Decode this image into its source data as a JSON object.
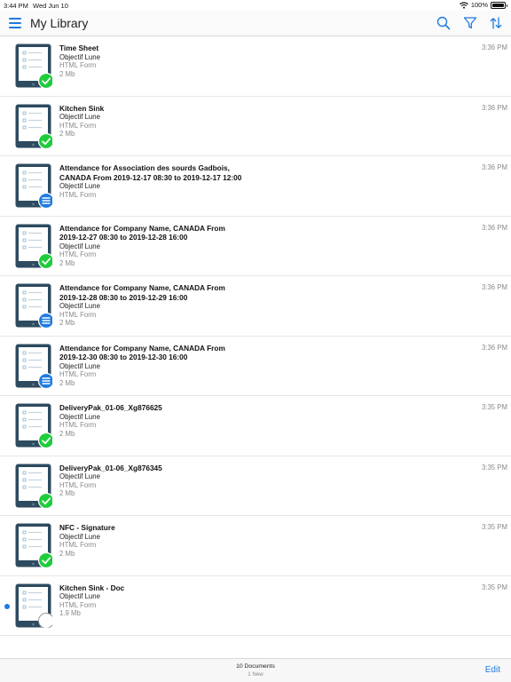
{
  "status_bar": {
    "time": "3:44 PM",
    "date": "Wed Jun 10",
    "battery": "100%",
    "battery_level": 1.0
  },
  "nav": {
    "title": "My Library",
    "menu_icon": "hamburger-menu-icon",
    "search_icon": "search-icon",
    "filter_icon": "filter-icon",
    "sort_icon": "sort-icon"
  },
  "colors": {
    "accent": "#1e7be0",
    "check_badge": "#1fcc3c",
    "form_badge": "#1e7be0",
    "device_frame": "#2d4a5f"
  },
  "documents": [
    {
      "name": "Time Sheet",
      "company": "Objectif Lune",
      "type": "HTML Form",
      "size": "2 Mb",
      "time": "3:36 PM",
      "status": "check-icon",
      "is_new": false
    },
    {
      "name": "Kitchen Sink",
      "company": "Objectif Lune",
      "type": "HTML Form",
      "size": "2 Mb",
      "time": "3:36 PM",
      "status": "check-icon",
      "is_new": false
    },
    {
      "name": "Attendance for Association des sourds Gadbois, CANADA From 2019-12-17 08:30 to 2019-12-17 12:00",
      "company": "Objectif Lune",
      "type": "HTML Form",
      "size": "",
      "time": "3:36 PM",
      "status": "list-icon",
      "is_new": false
    },
    {
      "name": "Attendance for Company Name, CANADA From 2019-12-27 08:30 to 2019-12-28 16:00",
      "company": "Objectif Lune",
      "type": "HTML Form",
      "size": "2 Mb",
      "time": "3:36 PM",
      "status": "check-icon",
      "is_new": false
    },
    {
      "name": "Attendance for Company Name, CANADA From 2019-12-28 08:30 to 2019-12-29 16:00",
      "company": "Objectif Lune",
      "type": "HTML Form",
      "size": "2 Mb",
      "time": "3:36 PM",
      "status": "list-icon",
      "is_new": false
    },
    {
      "name": "Attendance for Company Name, CANADA From 2019-12-30 08:30 to 2019-12-30 16:00",
      "company": "Objectif Lune",
      "type": "HTML Form",
      "size": "2 Mb",
      "time": "3:36 PM",
      "status": "list-icon",
      "is_new": false
    },
    {
      "name": "DeliveryPak_01-06_Xg876625",
      "company": "Objectif Lune",
      "type": "HTML Form",
      "size": "2 Mb",
      "time": "3:35 PM",
      "status": "check-icon",
      "is_new": false
    },
    {
      "name": "DeliveryPak_01-06_Xg876345",
      "company": "Objectif Lune",
      "type": "HTML Form",
      "size": "2 Mb",
      "time": "3:35 PM",
      "status": "check-icon",
      "is_new": false
    },
    {
      "name": "NFC - Signature",
      "company": "Objectif Lune",
      "type": "HTML Form",
      "size": "2 Mb",
      "time": "3:35 PM",
      "status": "check-icon",
      "is_new": false
    },
    {
      "name": "Kitchen Sink - Doc",
      "company": "Objectif Lune",
      "type": "HTML Form",
      "size": "1.9 Mb",
      "time": "3:35 PM",
      "status": "empty-circle-icon",
      "is_new": true
    }
  ],
  "footer": {
    "count": "10 Documents",
    "new_count": "1 New",
    "edit_label": "Edit"
  }
}
